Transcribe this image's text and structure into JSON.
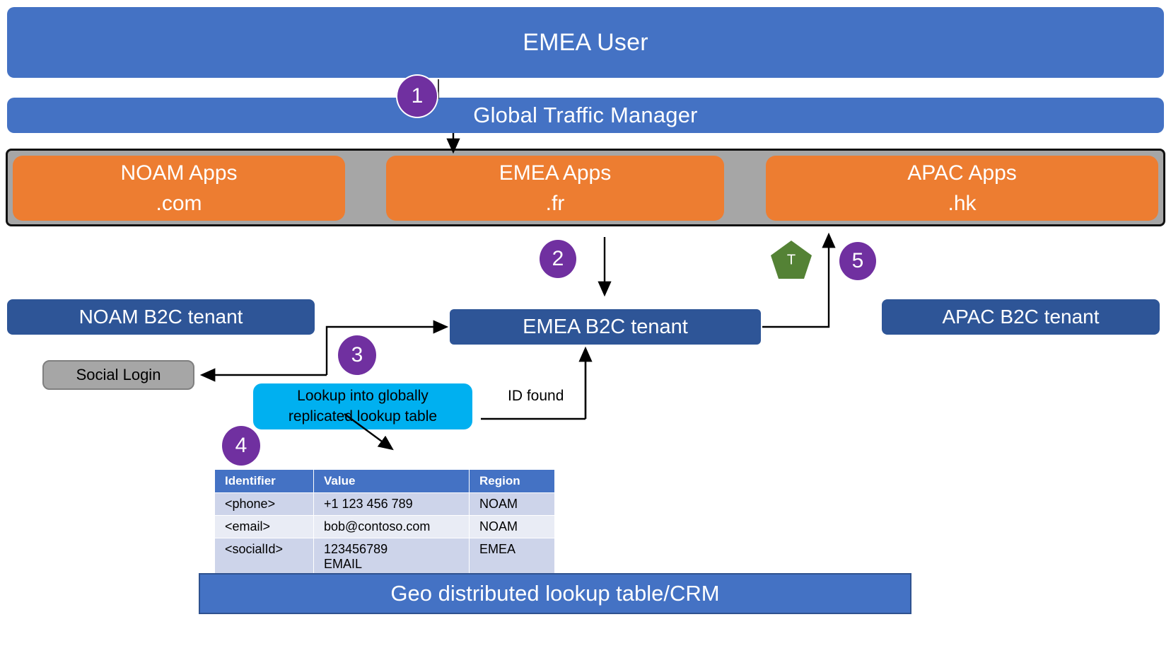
{
  "diagram": {
    "title": "Azure AD B2C multi-region tenant routing",
    "colors": {
      "primary_blue": "#4472C4",
      "tenant_navy": "#2E5597",
      "app_orange": "#ED7D31",
      "container_gray": "#A6A6A6",
      "badge_purple": "#7030A0",
      "callout_cyan": "#00B0F0",
      "pentagon_green": "#548235"
    }
  },
  "header": {
    "user_bar": "EMEA User",
    "traffic_manager_bar": "Global Traffic Manager"
  },
  "apps": [
    {
      "name": "NOAM Apps",
      "domain": ".com"
    },
    {
      "name": "EMEA Apps",
      "domain": ".fr"
    },
    {
      "name": "APAC Apps",
      "domain": ".hk"
    }
  ],
  "tenants": {
    "noam": "NOAM B2C tenant",
    "emea": "EMEA B2C tenant",
    "apac": "APAC B2C tenant"
  },
  "social_login": "Social Login",
  "callout": {
    "line1": "Lookup into globally",
    "line2": "replicated lookup table"
  },
  "labels": {
    "id_found": "ID found",
    "pentagon": "T"
  },
  "steps": [
    {
      "number": "1"
    },
    {
      "number": "2"
    },
    {
      "number": "3"
    },
    {
      "number": "4"
    },
    {
      "number": "5"
    }
  ],
  "lookup_table": {
    "columns": [
      "Identifier",
      "Value",
      "Region"
    ],
    "rows": [
      {
        "identifier": "<phone>",
        "value": "+1 123 456 789",
        "value2": "",
        "region": "NOAM"
      },
      {
        "identifier": "<email>",
        "value": "bob@contoso.com",
        "value2": "",
        "region": "NOAM"
      },
      {
        "identifier": "<socialId>",
        "value": "123456789",
        "value2": "EMAIL",
        "region": "EMEA"
      }
    ]
  },
  "footer": {
    "bar": "Geo distributed lookup table/CRM"
  }
}
